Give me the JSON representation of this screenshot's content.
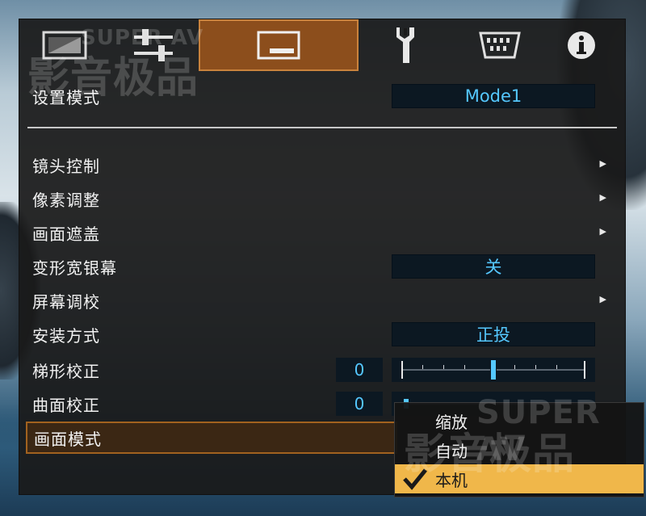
{
  "watermark": {
    "latin": "SUPER AV",
    "cjk": "影音极品"
  },
  "tabs": [
    {
      "name": "tab-picture",
      "icon": "picture-icon"
    },
    {
      "name": "tab-adjust",
      "icon": "sliders-icon"
    },
    {
      "name": "tab-installation",
      "icon": "screen-icon",
      "active": true
    },
    {
      "name": "tab-settings",
      "icon": "wrench-icon"
    },
    {
      "name": "tab-input",
      "icon": "connector-icon"
    },
    {
      "name": "tab-info",
      "icon": "info-icon"
    }
  ],
  "menu": {
    "setting_mode": {
      "label": "设置模式",
      "value": "Mode1"
    },
    "lens_control": {
      "label": "镜头控制"
    },
    "pixel_adjust": {
      "label": "像素调整"
    },
    "picture_mask": {
      "label": "画面遮盖"
    },
    "anamorphic": {
      "label": "变形宽银幕",
      "value": "关"
    },
    "screen_adjust": {
      "label": "屏幕调校"
    },
    "installation_style": {
      "label": "安装方式",
      "value": "正投"
    },
    "keystone": {
      "label": "梯形校正",
      "value": "0"
    },
    "curved_correction": {
      "label": "曲面校正",
      "value": "0"
    },
    "picture_mode": {
      "label": "画面模式"
    }
  },
  "popup": {
    "options": [
      "缩放",
      "自动",
      "本机"
    ],
    "selected": "本机"
  },
  "colors": {
    "accent_active_tab": "#8c4e1c",
    "value_text": "#55c8ff",
    "popup_highlight": "#f0b74a"
  }
}
